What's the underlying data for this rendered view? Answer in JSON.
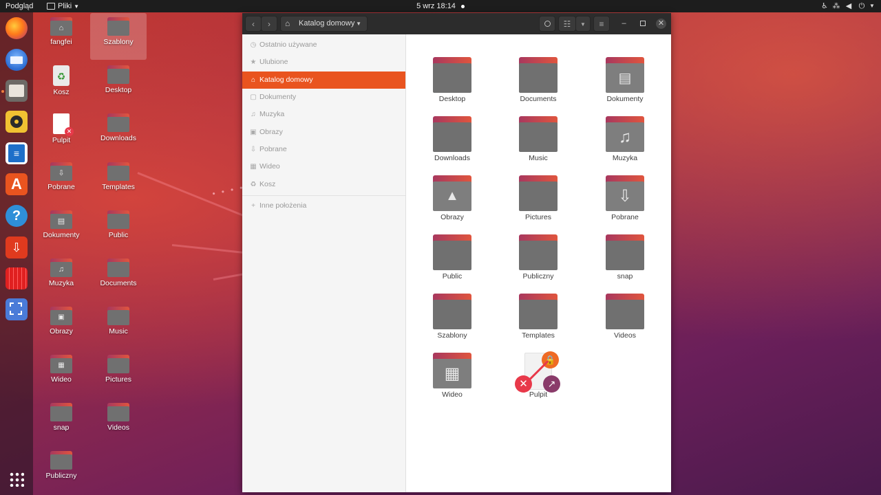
{
  "topbar": {
    "activities": "Podgląd",
    "app_menu": "Pliki",
    "clock": "5 wrz  18:14"
  },
  "dock": {
    "apps": [
      {
        "name": "Firefox",
        "color": "#e66000"
      },
      {
        "name": "Thunderbird",
        "color": "#2a6bd1"
      },
      {
        "name": "Pliki",
        "color": "#d9d2c7"
      },
      {
        "name": "Rhythmbox",
        "color": "#f4c542"
      },
      {
        "name": "LibreOffice Writer",
        "color": "#1e6fc9"
      },
      {
        "name": "Ubuntu Software",
        "color": "#e9541f"
      },
      {
        "name": "Pomoc",
        "color": "#2f8fd8"
      },
      {
        "name": "Instalator",
        "color": "#e03a1e"
      },
      {
        "name": "Kalendarz",
        "color": "#e02020"
      },
      {
        "name": "Zrzut ekranu",
        "color": "#4a7bd8"
      }
    ]
  },
  "desktop": {
    "icons": [
      {
        "label": "fangfei",
        "glyph": "⌂"
      },
      {
        "label": "Szablony",
        "glyph": ""
      },
      {
        "label": "Kosz",
        "glyph": "♻"
      },
      {
        "label": "Desktop",
        "glyph": ""
      },
      {
        "label": "Pulpit",
        "glyph": ""
      },
      {
        "label": "Downloads",
        "glyph": ""
      },
      {
        "label": "Pobrane",
        "glyph": "⇩"
      },
      {
        "label": "Templates",
        "glyph": ""
      },
      {
        "label": "Dokumenty",
        "glyph": "▤"
      },
      {
        "label": "Public",
        "glyph": ""
      },
      {
        "label": "Muzyka",
        "glyph": "♫"
      },
      {
        "label": "Documents",
        "glyph": ""
      },
      {
        "label": "Obrazy",
        "glyph": "▣"
      },
      {
        "label": "Music",
        "glyph": ""
      },
      {
        "label": "Wideo",
        "glyph": "▦"
      },
      {
        "label": "Pictures",
        "glyph": ""
      },
      {
        "label": "snap",
        "glyph": ""
      },
      {
        "label": "Videos",
        "glyph": ""
      },
      {
        "label": "Publiczny",
        "glyph": ""
      }
    ]
  },
  "window": {
    "location": "Katalog domowy",
    "sidebar": [
      {
        "label": "Ostatnio używane",
        "icon": "◷"
      },
      {
        "label": "Ulubione",
        "icon": "★"
      },
      {
        "label": "Katalog domowy",
        "icon": "⌂"
      },
      {
        "label": "Dokumenty",
        "icon": "▢"
      },
      {
        "label": "Muzyka",
        "icon": "♫"
      },
      {
        "label": "Obrazy",
        "icon": "▣"
      },
      {
        "label": "Pobrane",
        "icon": "⇩"
      },
      {
        "label": "Wideo",
        "icon": "▦"
      },
      {
        "label": "Kosz",
        "icon": "♻"
      },
      {
        "label": "Inne położenia",
        "icon": "+"
      }
    ],
    "files": [
      {
        "label": "Desktop",
        "glyph": ""
      },
      {
        "label": "Documents",
        "glyph": ""
      },
      {
        "label": "Dokumenty",
        "glyph": "▤"
      },
      {
        "label": "Downloads",
        "glyph": ""
      },
      {
        "label": "Music",
        "glyph": ""
      },
      {
        "label": "Muzyka",
        "glyph": "♫"
      },
      {
        "label": "Obrazy",
        "glyph": "▲"
      },
      {
        "label": "Pictures",
        "glyph": ""
      },
      {
        "label": "Pobrane",
        "glyph": "⇩"
      },
      {
        "label": "Public",
        "glyph": ""
      },
      {
        "label": "Publiczny",
        "glyph": ""
      },
      {
        "label": "snap",
        "glyph": ""
      },
      {
        "label": "Szablony",
        "glyph": ""
      },
      {
        "label": "Templates",
        "glyph": ""
      },
      {
        "label": "Videos",
        "glyph": ""
      },
      {
        "label": "Wideo",
        "glyph": "▦"
      },
      {
        "label": "Pulpit",
        "glyph": ""
      }
    ]
  },
  "colors": {
    "accent": "#e9541f",
    "folder_tab": "#c7425a",
    "folder_body": "#707070"
  }
}
